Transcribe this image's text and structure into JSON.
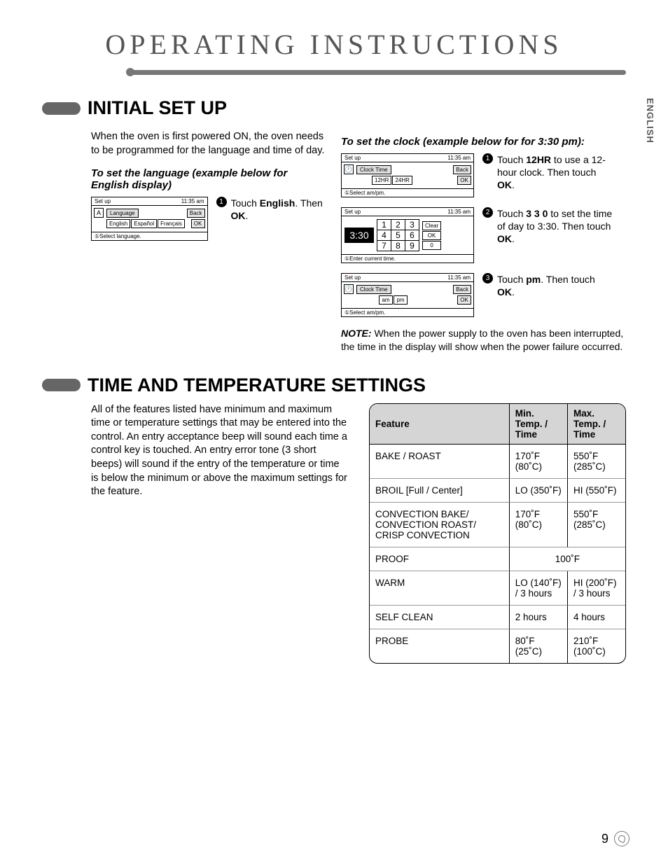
{
  "main_title": "OPERATING INSTRUCTIONS",
  "vtab": "ENGLISH",
  "page_number": "9",
  "section1": {
    "title": "INITIAL SET UP",
    "intro": "When the oven is first powered ON, the oven needs to be programmed for the language and time of day.",
    "lang_head": "To set the language (example below for English display)",
    "clock_head": "To set the clock (example below for for 3:30 pm):",
    "lang_screen": {
      "tl": "Set up",
      "tr": "11:35 am",
      "label": "Language",
      "btns": [
        "English",
        "Español",
        "Français"
      ],
      "back": "Back",
      "ok": "OK",
      "foot": "①Select language."
    },
    "lang_step": {
      "n": "1",
      "pre": "Touch ",
      "b1": "English",
      "mid": ". Then ",
      "b2": "OK",
      "post": "."
    },
    "clock_s1": {
      "tl": "Set up",
      "tr": "11:35 am",
      "label": "Clock Time",
      "b1": "12HR",
      "b2": "24HR",
      "back": "Back",
      "ok": "OK",
      "foot": "①Select am/pm."
    },
    "clock_step1": {
      "n": "1",
      "pre": "Touch ",
      "b1": "12HR",
      "mid": " to use a 12-hour clock. Then touch ",
      "b2": "OK",
      "post": "."
    },
    "clock_s2": {
      "tl": "Set up",
      "tr": "11:35 am",
      "disp": "3:30",
      "keys": [
        "1",
        "2",
        "3",
        "4",
        "5",
        "6",
        "7",
        "8",
        "9",
        "0"
      ],
      "clear": "Clear",
      "ok": "OK",
      "foot": "①Enter current time."
    },
    "clock_step2": {
      "n": "2",
      "pre": "Touch ",
      "b1": "3 3 0",
      "mid": " to set the time of day to 3:30. Then touch ",
      "b2": "OK",
      "post": "."
    },
    "clock_s3": {
      "tl": "Set up",
      "tr": "11:35 am",
      "label": "Clock Time",
      "b1": "am",
      "b2": "pm",
      "back": "Back",
      "ok": "OK",
      "foot": "①Select am/pm."
    },
    "clock_step3": {
      "n": "3",
      "pre": "Touch ",
      "b1": "pm",
      "mid": ". Then touch ",
      "b2": "OK",
      "post": "."
    },
    "note_label": "NOTE:",
    "note_text": "  When the power supply to the oven has been interrupted, the time in the display will show when the power failure occurred."
  },
  "section2": {
    "title": "TIME AND TEMPERATURE SETTINGS",
    "body": "All of the features listed have minimum and maximum time or temperature settings that may be entered into the control. An entry acceptance beep will sound each time a control key is touched. An entry error tone (3 short beeps) will sound if the entry of the temperature or time is below the minimum or above the maximum settings for the feature.",
    "headers": [
      "Feature",
      "Min. Temp. / Time",
      "Max. Temp. / Time"
    ],
    "rows": [
      {
        "f": "BAKE / ROAST",
        "min": "170˚F (80˚C)",
        "max": "550˚F (285˚C)"
      },
      {
        "f": "BROIL [Full / Center]",
        "min": "LO (350˚F)",
        "max": "HI (550˚F)"
      },
      {
        "f": "CONVECTION BAKE/ CONVECTION ROAST/ CRISP CONVECTION",
        "min": "170˚F (80˚C)",
        "max": "550˚F (285˚C)"
      },
      {
        "f": "PROOF",
        "span": "100˚F"
      },
      {
        "f": "WARM",
        "min": "LO (140˚F) / 3 hours",
        "max": "HI (200˚F) / 3 hours"
      },
      {
        "f": "SELF CLEAN",
        "min": "2 hours",
        "max": "4 hours"
      },
      {
        "f": "PROBE",
        "min": "80˚F (25˚C)",
        "max": "210˚F (100˚C)"
      }
    ]
  }
}
